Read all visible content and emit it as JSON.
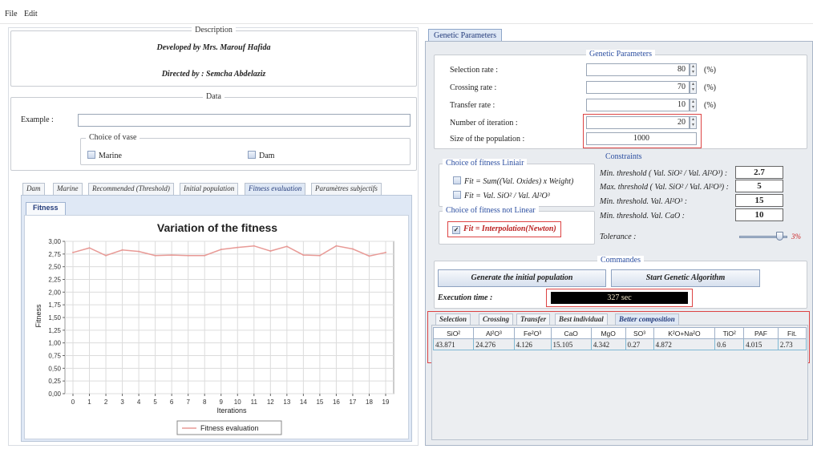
{
  "menu": {
    "file": "File",
    "edit": "Edit"
  },
  "description": {
    "legend": "Description",
    "developed": "Developed by Mrs. Marouf Hafida",
    "directed": "Directed by : Semcha Abdelaziz"
  },
  "data": {
    "legend": "Data",
    "example_label": "Example :",
    "example_value": "",
    "vase_legend": "Choice of vase",
    "vase_options": [
      "Marine",
      "Dam"
    ]
  },
  "left_tabs": [
    "Dam",
    "Marine",
    "Recommended (Threshold)",
    "Initial population",
    "Fitness evaluation",
    "Paramètres subjectifs"
  ],
  "inner_tab": "Fitness",
  "right_tab": "Genetic Parameters",
  "genetic": {
    "legend": "Genetic Parameters",
    "rows": [
      {
        "label": "Selection rate :",
        "value": "80",
        "unit": "(%)"
      },
      {
        "label": "Crossing rate :",
        "value": "70",
        "unit": "(%)"
      },
      {
        "label": "Transfer rate :",
        "value": "10",
        "unit": "(%)"
      },
      {
        "label": "Number of iteration :",
        "value": "20",
        "unit": ""
      },
      {
        "label": "Size of the population :",
        "value": "1000",
        "unit": ""
      }
    ]
  },
  "fitness_linear": {
    "legend": "Choice of fitness Liniair",
    "options": [
      "Fit = Sum((Val. Oxides) x Weight)",
      "Fit = Val. SiO² / Val. Al²O³"
    ]
  },
  "fitness_nonlinear": {
    "legend": "Choice of fitness not Linear",
    "option": "Fit = Interpolation(Newton)"
  },
  "constraints": {
    "legend": "Constraints",
    "rows": [
      {
        "label": "Min. threshold ( Val. SiO² / Val. Al²O³) :",
        "value": "2.7"
      },
      {
        "label": "Max. threshold ( Val. SiO² / Val. Al²O³) :",
        "value": "5"
      },
      {
        "label": "Min. threshold. Val. Al²O³ :",
        "value": "15"
      },
      {
        "label": "Min. threshold. Val. CaO :",
        "value": "10"
      }
    ],
    "tolerance_label": "Tolerance :",
    "tolerance_value": "3%",
    "tolerance_level": 0.9
  },
  "commands": {
    "legend": "Commandes",
    "generate": "Generate the initial population",
    "start": "Start Genetic Algorithm",
    "exec_label": "Execution time :",
    "exec_value": "327 sec"
  },
  "result_tabs": [
    "Selection",
    "Crossing",
    "Transfer",
    "Best individual",
    "Better composition"
  ],
  "result_table": {
    "headers": [
      "SiO²",
      "Al²O³",
      "Fe²O³",
      "CaO",
      "MgO",
      "SO³",
      "K²O+Na²O",
      "TiO²",
      "PAF",
      "Fit."
    ],
    "row": [
      "43.871",
      "24.276",
      "4.126",
      "15.105",
      "4.342",
      "0.27",
      "4.872",
      "0.6",
      "4.015",
      "2.73"
    ]
  },
  "colors": {
    "accent": "#dd3333",
    "line": "#e89a96",
    "tab_blue": "#c6d6ee"
  },
  "chart_data": {
    "type": "line",
    "title": "Variation of the fitness",
    "xlabel": "Iterations",
    "ylabel": "Fitness",
    "x": [
      0,
      1,
      2,
      3,
      4,
      5,
      6,
      7,
      8,
      9,
      10,
      11,
      12,
      13,
      14,
      15,
      16,
      17,
      18,
      19
    ],
    "xticks": [
      "0",
      "1",
      "2",
      "3",
      "4",
      "5",
      "6",
      "7",
      "8",
      "9",
      "10",
      "11",
      "12",
      "13",
      "14",
      "15",
      "16",
      "17",
      "18",
      "19"
    ],
    "yticks": [
      "0,00",
      "0,25",
      "0,50",
      "0,75",
      "1,00",
      "1,25",
      "1,50",
      "1,75",
      "2,00",
      "2,25",
      "2,50",
      "2,75",
      "3,00"
    ],
    "ylim": [
      0,
      3.0
    ],
    "grid": true,
    "legend_position": "bottom",
    "series": [
      {
        "name": "Fitness evaluation",
        "values": [
          2.78,
          2.87,
          2.72,
          2.83,
          2.8,
          2.72,
          2.73,
          2.72,
          2.72,
          2.84,
          2.88,
          2.91,
          2.81,
          2.9,
          2.73,
          2.72,
          2.91,
          2.85,
          2.71,
          2.78
        ]
      }
    ]
  }
}
